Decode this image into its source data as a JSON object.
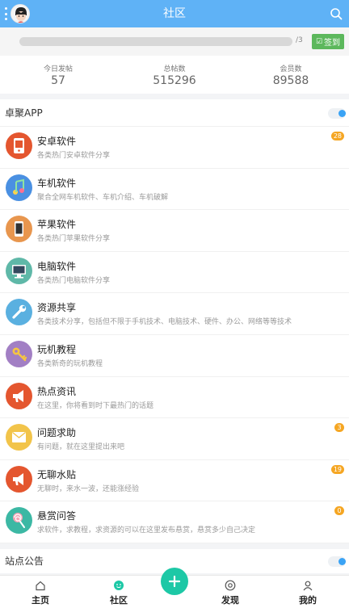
{
  "header": {
    "title": "社区",
    "menu_icon": "menu-dots-icon",
    "avatar_icon": "avatar",
    "search_icon": "search-icon"
  },
  "checkin": {
    "progress_text": "/3",
    "progress_fraction": 0,
    "button_label": "签到",
    "button_color": "#5cb85c"
  },
  "stats": [
    {
      "label": "今日发帖",
      "value": "57"
    },
    {
      "label": "总帖数",
      "value": "515296"
    },
    {
      "label": "会员数",
      "value": "89588"
    }
  ],
  "section": {
    "title": "卓聚APP",
    "items": [
      {
        "title": "安卓软件",
        "desc": "各类热门安卓软件分享",
        "badge": "28",
        "icon": "android-phone-icon",
        "color": "#e4562f"
      },
      {
        "title": "车机软件",
        "desc": "聚合全网车机软件、车机介绍、车机破解",
        "badge": "",
        "icon": "music-note-icon",
        "color": "#4a90e2"
      },
      {
        "title": "苹果软件",
        "desc": "各类热门苹果软件分享",
        "badge": "",
        "icon": "iphone-icon",
        "color": "#e8964e"
      },
      {
        "title": "电脑软件",
        "desc": "各类热门电脑软件分享",
        "badge": "",
        "icon": "monitor-icon",
        "color": "#5fb8a8"
      },
      {
        "title": "资源共享",
        "desc": "各类技术分享，包括但不限于手机技术、电脑技术、硬件、办公、网络等等技术",
        "badge": "",
        "icon": "wrench-icon",
        "color": "#5ab0e0"
      },
      {
        "title": "玩机教程",
        "desc": "各类新奇的玩机教程",
        "badge": "",
        "icon": "key-icon",
        "color": "#a27fc4"
      },
      {
        "title": "热点资讯",
        "desc": "在这里，你将看到时下最热门的话题",
        "badge": "",
        "icon": "megaphone-icon",
        "color": "#e4562f"
      },
      {
        "title": "问题求助",
        "desc": "有问题，就在这里提出来吧",
        "badge": "3",
        "icon": "envelope-icon",
        "color": "#f2c44a"
      },
      {
        "title": "无聊水贴",
        "desc": "无聊时，来水一波，还能涨经验",
        "badge": "19",
        "icon": "megaphone-icon",
        "color": "#e4562f"
      },
      {
        "title": "悬赏问答",
        "desc": "求软件，求教程，求资源的可以在这里发布悬赏，悬赏多少自己决定",
        "badge": "0",
        "icon": "lollipop-icon",
        "color": "#3cb8a4"
      }
    ]
  },
  "notice": {
    "title": "站点公告"
  },
  "bottom_nav": [
    {
      "label": "主页",
      "icon": "home-icon"
    },
    {
      "label": "社区",
      "icon": "community-icon"
    },
    {
      "label": "发现",
      "icon": "discover-icon"
    },
    {
      "label": "我的",
      "icon": "profile-icon"
    }
  ],
  "fab_icon": "plus-icon",
  "accent_color": "#5fb2f6"
}
